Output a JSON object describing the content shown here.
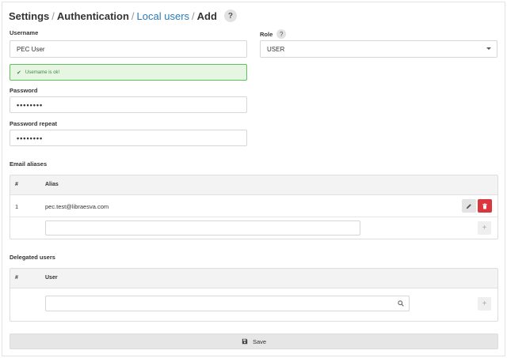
{
  "breadcrumb": {
    "items": [
      "Settings",
      "Authentication",
      "Local users",
      "Add"
    ],
    "separator": "/",
    "help_glyph": "?"
  },
  "form": {
    "username": {
      "label": "Username",
      "value": "PEC User"
    },
    "username_ok": {
      "message": "Username is ok!",
      "icon": "check-icon"
    },
    "password": {
      "label": "Password",
      "value": "••••••••"
    },
    "password_repeat": {
      "label": "Password repeat",
      "value": "••••••••"
    },
    "role": {
      "label": "Role",
      "help_glyph": "?",
      "value": "USER"
    }
  },
  "email_aliases": {
    "title": "Email aliases",
    "columns": [
      "#",
      "Alias"
    ],
    "rows": [
      {
        "index": "1",
        "alias": "pec.test@libraesva.com"
      }
    ],
    "new_alias": {
      "value": ""
    },
    "edit_icon": "pencil-icon",
    "delete_icon": "trash-icon",
    "add_glyph": "+"
  },
  "delegated_users": {
    "title": "Delegated users",
    "columns": [
      "#",
      "User"
    ],
    "search": {
      "value": ""
    },
    "add_glyph": "+"
  },
  "save": {
    "label": "Save",
    "icon": "floppy-disk-icon"
  },
  "colors": {
    "link": "#2a7ab8",
    "success_border": "#5cc05c",
    "success_bg": "#e7f6e3",
    "danger": "#d9363e"
  }
}
